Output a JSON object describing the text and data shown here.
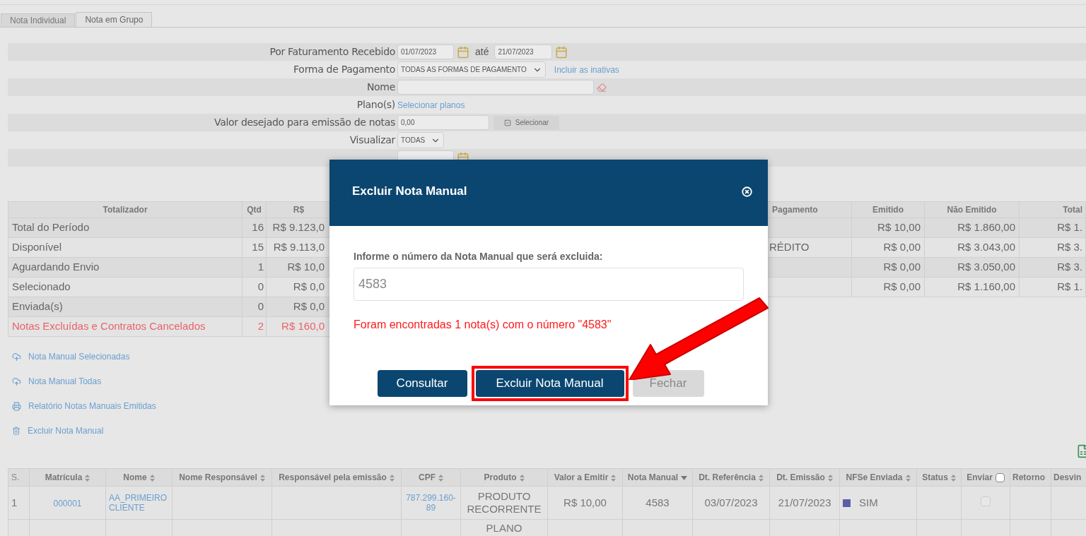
{
  "tabs": [
    {
      "label": "Nota Individual",
      "selected": false
    },
    {
      "label": "Nota em Grupo",
      "selected": true
    }
  ],
  "filters": [
    {
      "kind": "date_range",
      "label": "Por Faturamento Recebido",
      "from": "01/07/2023",
      "separator": "até",
      "to": "21/07/2023"
    },
    {
      "kind": "select",
      "label": "Forma de Pagamento",
      "value": "TODAS AS FORMAS DE PAGAMENTO",
      "link": "Incluir as inativas"
    },
    {
      "kind": "text",
      "label": "Nome"
    },
    {
      "kind": "link",
      "label": "Plano(s)",
      "link": "Selecionar planos"
    },
    {
      "kind": "amount",
      "label": "Valor desejado para emissão de notas",
      "value": "0,00",
      "button": "Selecionar"
    },
    {
      "kind": "select",
      "label": "Visualizar",
      "value": "TODAS"
    },
    {
      "kind": "date"
    }
  ],
  "summary": {
    "columns": [
      "Totalizador",
      "Qtd",
      "R$"
    ],
    "rows": [
      {
        "label": "Total do Período",
        "qtd": "16",
        "value": "R$ 9.123,0",
        "alert": false
      },
      {
        "label": "Disponível",
        "qtd": "15",
        "value": "R$ 9.113,0",
        "alert": false
      },
      {
        "label": "Aguardando Envio",
        "qtd": "1",
        "value": "R$ 10,0",
        "alert": false
      },
      {
        "label": "Selecionado",
        "qtd": "0",
        "value": "R$ 0,0",
        "alert": false
      },
      {
        "label": "Enviada(s)",
        "qtd": "0",
        "value": "R$ 0,0",
        "alert": false
      },
      {
        "label": "Notas Excluídas e Contratos Cancelados",
        "qtd": "2",
        "value": "R$ 160,0",
        "alert": true
      }
    ]
  },
  "payments": {
    "columns": [
      "Pagamento",
      "Emitido",
      "Não Emitido",
      "Total"
    ],
    "rows": [
      [
        "",
        "R$ 10,00",
        "R$ 1.860,00",
        "R$ 1."
      ],
      [
        "RÉDITO",
        "R$ 0,00",
        "R$ 3.043,00",
        "R$ 3."
      ],
      [
        "",
        "R$ 0,00",
        "R$ 3.050,00",
        "R$ 3."
      ],
      [
        "",
        "R$ 0,00",
        "R$ 1.160,00",
        "R$ 1."
      ]
    ]
  },
  "actions": [
    {
      "kind": "upload",
      "label": "Nota Manual Selecionadas"
    },
    {
      "kind": "upload",
      "label": "Nota Manual Todas"
    },
    {
      "kind": "print",
      "label": "Relatório Notas Manuais Emitidas"
    },
    {
      "kind": "delete",
      "label": "Excluir Nota Manual"
    }
  ],
  "table": {
    "columns": [
      {
        "label": "S.",
        "kind": "index"
      },
      {
        "label": "Matrícula",
        "kind": "sortable"
      },
      {
        "label": "Nome",
        "kind": "sortable"
      },
      {
        "label": "Nome Responsável",
        "kind": "sortable"
      },
      {
        "label": "Responsável pela emissão",
        "kind": "sortable"
      },
      {
        "label": "CPF",
        "kind": "sortable"
      },
      {
        "label": "Produto",
        "kind": "sortable"
      },
      {
        "label": "Valor a Emitir",
        "kind": "sortable"
      },
      {
        "label": "Nota Manual",
        "kind": "sorted"
      },
      {
        "label": "Dt. Referência",
        "kind": "sortable"
      },
      {
        "label": "Dt. Emissão",
        "kind": "sortable"
      },
      {
        "label": "NFSe Enviada",
        "kind": "sortable"
      },
      {
        "label": "Status",
        "kind": "sortable"
      },
      {
        "label": "Enviar",
        "kind": "checkbox",
        "checked": false
      },
      {
        "label": "Retorno",
        "kind": "plain"
      },
      {
        "label": "Desvin",
        "kind": "plain"
      }
    ],
    "rows": [
      {
        "index": "1",
        "matricula": "000001",
        "nome": "AA_PRIMEIRO CLIENTE",
        "cpf": "787.299.160-89",
        "produto": "PRODUTO RECORRENTE",
        "valor": "R$ 10,00",
        "nota": "4583",
        "dt_ref": "03/07/2023",
        "dt_emissao": "21/07/2023",
        "nfse": "SIM",
        "color": "#5b5ea6",
        "enviar": false
      },
      {
        "produto": "PLANO"
      }
    ]
  },
  "modal": {
    "title": "Excluir Nota Manual",
    "label": "Informe o número da Nota Manual que será excluida:",
    "value": "4583",
    "message": "Foram encontradas 1 nota(s) com o número \"4583\"",
    "buttons": [
      {
        "label": "Consultar",
        "kind": "primary",
        "highlighted": false
      },
      {
        "label": "Excluir Nota Manual",
        "kind": "primary",
        "highlighted": true
      },
      {
        "label": "Fechar",
        "kind": "secondary",
        "highlighted": false
      }
    ]
  }
}
